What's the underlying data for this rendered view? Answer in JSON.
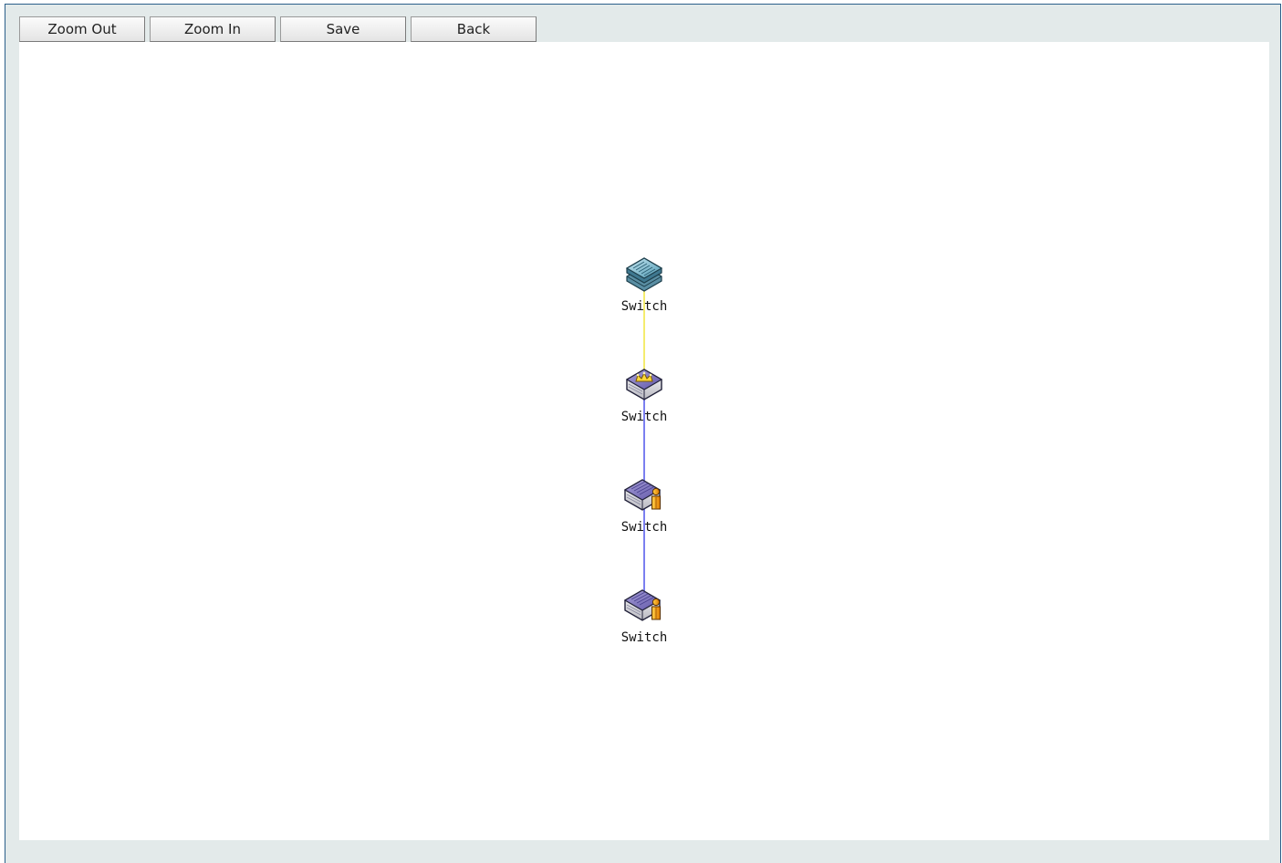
{
  "toolbar": {
    "zoom_out_label": "Zoom Out",
    "zoom_in_label": "Zoom In",
    "save_label": "Save",
    "back_label": "Back"
  },
  "topology": {
    "nodes": [
      {
        "label": "Switch",
        "icon": "switch-stack-icon"
      },
      {
        "label": "Switch",
        "icon": "switch-master-crown-icon"
      },
      {
        "label": "Switch",
        "icon": "switch-member-icon"
      },
      {
        "label": "Switch",
        "icon": "switch-member-icon"
      }
    ],
    "links": [
      {
        "from": 0,
        "to": 1,
        "color": "#f5ec6e"
      },
      {
        "from": 1,
        "to": 2,
        "color": "#7b7ff0"
      },
      {
        "from": 2,
        "to": 3,
        "color": "#7b7ff0"
      }
    ]
  },
  "colors": {
    "frame_border": "#2a5f8a",
    "frame_background": "#e3eaea",
    "canvas_background": "#ffffff"
  }
}
